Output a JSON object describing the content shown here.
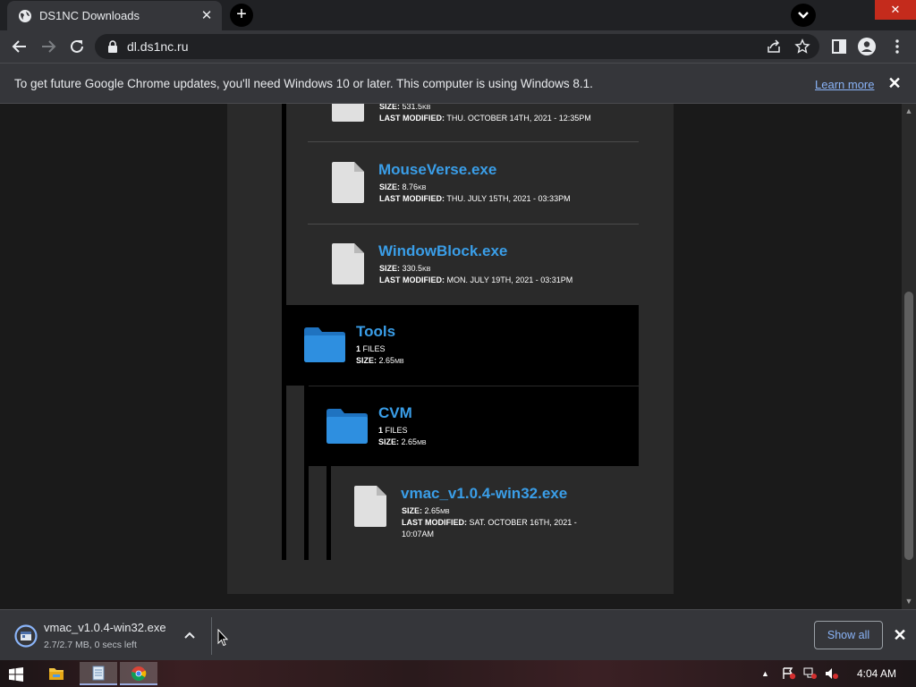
{
  "browser": {
    "tab": {
      "title": "DS1NC Downloads",
      "close_glyph": "✕"
    },
    "new_tab_glyph": "+",
    "window_close_glyph": "✕",
    "url": "dl.ds1nc.ru"
  },
  "infobar": {
    "message": "To get future Google Chrome updates, you'll need Windows 10 or later. This computer is using Windows 8.1.",
    "link": "Learn more",
    "close_glyph": "✕"
  },
  "listing": {
    "partial_file": {
      "size_label": "SIZE:",
      "size": "531.5",
      "modified_label": "LAST MODIFIED:",
      "modified": "THU. OCTOBER 14TH, 2021 - 12:35PM"
    },
    "files": [
      {
        "name": "MouseVerse.exe",
        "size_label": "SIZE:",
        "size": "8.76",
        "modified_label": "LAST MODIFIED:",
        "modified": "THU. JULY 15TH, 2021 - 03:33PM"
      },
      {
        "name": "WindowBlock.exe",
        "size_label": "SIZE:",
        "size": "330.5",
        "modified_label": "LAST MODIFIED:",
        "modified": "MON. JULY 19TH, 2021 - 03:31PM"
      }
    ],
    "folders": [
      {
        "name": "Tools",
        "count": "1",
        "files_label": "FILES",
        "size_label": "SIZE:",
        "size": "2.65"
      },
      {
        "name": "CVM",
        "count": "1",
        "files_label": "FILES",
        "size_label": "SIZE:",
        "size": "2.65"
      }
    ],
    "nested_file": {
      "name": "vmac_v1.0.4-win32.exe",
      "size_label": "SIZE:",
      "size": "2.65",
      "modified_label": "LAST MODIFIED:",
      "modified_line1": "SAT. OCTOBER 16TH, 2021 -",
      "modified_line2": "10:07AM"
    },
    "unit_kb": "KB",
    "unit_mb": "MB"
  },
  "download": {
    "file_name": "vmac_v1.0.4-win32.exe",
    "status": "2.7/2.7 MB, 0 secs left",
    "show_all": "Show all",
    "close_glyph": "✕"
  },
  "taskbar": {
    "time": "4:04 AM"
  },
  "colors": {
    "link_blue": "#3a9ee8",
    "folder_blue": "#2e8fe0",
    "chrome_dark": "#35363a"
  }
}
